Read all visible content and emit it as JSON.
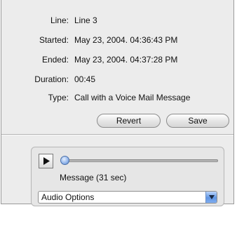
{
  "details": {
    "line_label": "Line:",
    "line_value": "Line 3",
    "started_label": "Started:",
    "started_value": "May 23, 2004. 04:36:43 PM",
    "ended_label": "Ended:",
    "ended_value": "May 23, 2004. 04:37:28 PM",
    "duration_label": "Duration:",
    "duration_value": "00:45",
    "type_label": "Type:",
    "type_value": "Call with a Voice Mail Message"
  },
  "buttons": {
    "revert": "Revert",
    "save": "Save"
  },
  "audio": {
    "message_label": "Message (31 sec)",
    "playback_position": 0,
    "options_selected": "Audio Options"
  },
  "icons": {
    "play": "play-icon",
    "dropdown": "chevron-down-icon"
  },
  "colors": {
    "panel_bg": "#ececec",
    "accent": "#5f95e3"
  }
}
